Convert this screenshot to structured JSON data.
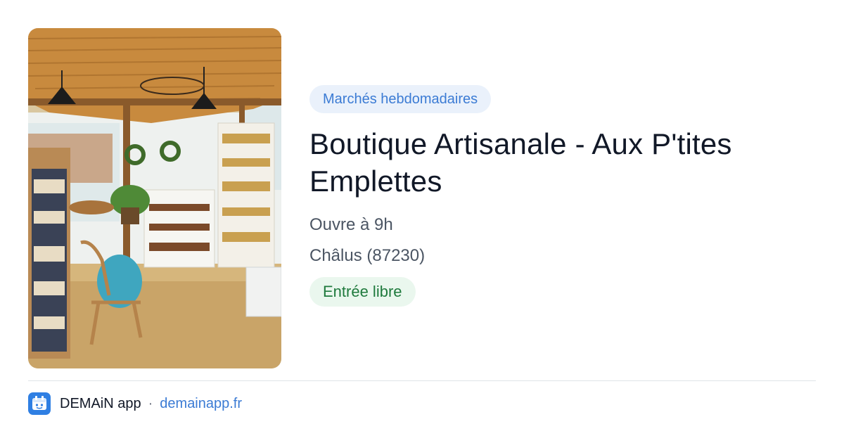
{
  "category": "Marchés hebdomadaires",
  "title": "Boutique Artisanale - Aux P'tites Emplettes",
  "hours": "Ouvre à 9h",
  "location": "Châlus (87230)",
  "access": "Entrée libre",
  "footer": {
    "app_name": "DEMAiN app",
    "separator": "·",
    "domain": "demainapp.fr"
  },
  "photo": {
    "subject": "shop-interior-photo"
  },
  "colors": {
    "category_bg": "#eaf1fb",
    "category_text": "#3b7bd4",
    "access_bg": "#eaf7ee",
    "access_text": "#1f7a3d",
    "link": "#3b7bd4",
    "app_icon": "#2f7fe3"
  }
}
